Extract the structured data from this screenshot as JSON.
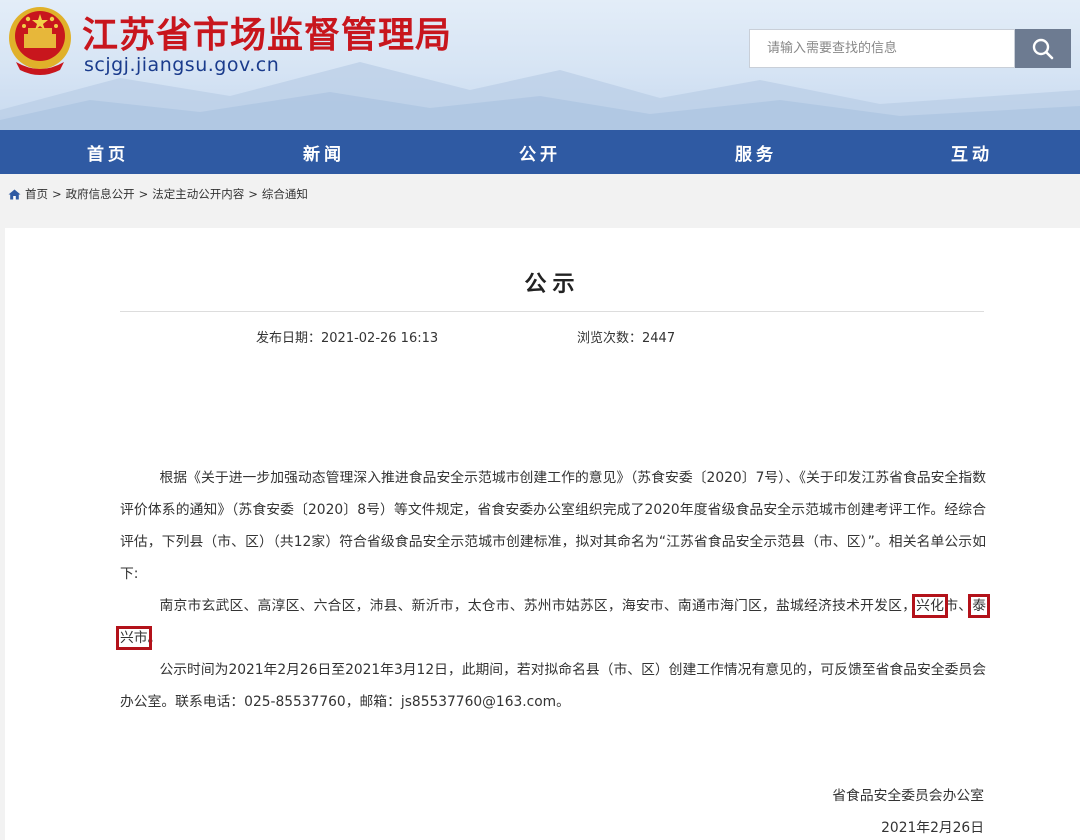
{
  "header": {
    "site_title": "江苏省市场监督管理局",
    "site_url": "scjgj.jiangsu.gov.cn",
    "search_placeholder": "请输入需要查找的信息"
  },
  "nav": [
    "首页",
    "新闻",
    "公开",
    "服务",
    "互动"
  ],
  "breadcrumb": [
    "首页",
    "政府信息公开",
    "法定主动公开内容",
    "综合通知"
  ],
  "article": {
    "title": "公示",
    "publish_date": "发布日期：2021-02-26 16:13",
    "view_count": "浏览次数：2447",
    "para1": "根据《关于进一步加强动态管理深入推进食品安全示范城市创建工作的意见》（苏食安委〔2020〕7号）、《关于印发江苏省食品安全指数评价体系的通知》（苏食安委〔2020〕8号）等文件规定，省食安委办公室组织完成了2020年度省级食品安全示范城市创建考评工作。经综合评估，下列县（市、区）（共12家）符合省级食品安全示范城市创建标准，拟对其命名为“江苏省食品安全示范县（市、区）”。相关名单公示如下:",
    "para2_a": "南京市玄武区、高淳区、六合区，沛县、新沂市，太仓市、苏州市姑苏区，海安市、南通市海门区，盐城经济技术开发区，",
    "para2_h1": "兴化",
    "para2_b": "市、",
    "para2_h2": "泰兴市",
    "para2_c": "。",
    "para3": "公示时间为2021年2月26日至2021年3月12日，此期间，若对拟命名县（市、区）创建工作情况有意见的，可反馈至省食品安全委员会办公室。联系电话：025-85537760，邮箱：js85537760@163.com。",
    "signer": "省食品安全委员会办公室",
    "sign_date": "2021年2月26日"
  },
  "colors": {
    "title_red": "#c8161d",
    "nav_blue": "#2f5aa3",
    "highlight_red": "#b3121a"
  },
  "icons": {
    "search": "search-icon",
    "home": "home-icon",
    "emblem": "national-emblem-icon"
  }
}
